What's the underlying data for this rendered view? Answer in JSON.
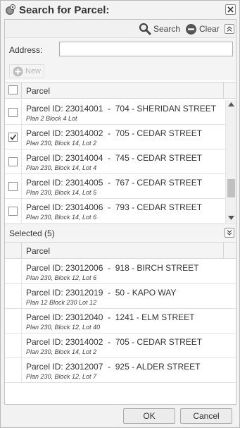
{
  "dialog": {
    "title": "Search for Parcel:"
  },
  "toolbar": {
    "search_label": "Search",
    "clear_label": "Clear"
  },
  "address": {
    "label": "Address:",
    "value": "",
    "placeholder": ""
  },
  "new_button": {
    "label": "New"
  },
  "results": {
    "column_header": "Parcel",
    "rows": [
      {
        "title": "Parcel ID: 23014001  -  704 - SHERIDAN STREET",
        "subtitle": "Plan 2 Block 4 Lot",
        "checked": false
      },
      {
        "title": "Parcel ID: 23014002  -  705 - CEDAR STREET",
        "subtitle": "Plan 230, Block 14, Lot 2",
        "checked": true
      },
      {
        "title": "Parcel ID: 23014004  -  745 - CEDAR STREET",
        "subtitle": "Plan 230, Block 14, Lot 4",
        "checked": false
      },
      {
        "title": "Parcel ID: 23014005  -  767 - CEDAR STREET",
        "subtitle": "Plan 230, Block 14, Lot 5",
        "checked": false
      },
      {
        "title": "Parcel ID: 23014006  -  793 - CEDAR STREET",
        "subtitle": "Plan 230, Block 14, Lot 6",
        "checked": false
      }
    ]
  },
  "selected": {
    "title": "Selected (5)",
    "column_header": "Parcel",
    "rows": [
      {
        "title": "Parcel ID: 23012006  -  918 - BIRCH STREET",
        "subtitle": "Plan 230, Block 12, Lot 6"
      },
      {
        "title": "Parcel ID: 23012019  -  50 - KAPO WAY",
        "subtitle": "Plan 12 Block 230 Lot 12"
      },
      {
        "title": "Parcel ID: 23012040  -  1241 - ELM STREET",
        "subtitle": "Plan 230, Block 12, Lot 40"
      },
      {
        "title": "Parcel ID: 23014002  -  705 - CEDAR STREET",
        "subtitle": "Plan 230, Block 14, Lot 2"
      },
      {
        "title": "Parcel ID: 23012007  -  925 - ALDER STREET",
        "subtitle": "Plan 230, Block 12, Lot 7"
      }
    ]
  },
  "footer": {
    "ok_label": "OK",
    "cancel_label": "Cancel"
  },
  "icons": {
    "title": "globe-pin-icon",
    "close": "close-icon",
    "search": "magnifier-icon",
    "clear": "clear-circle-icon",
    "collapse": "double-chevron-up-icon",
    "expand": "double-chevron-down-icon",
    "new": "plus-circle-icon",
    "checkmark": "checkmark-icon"
  }
}
